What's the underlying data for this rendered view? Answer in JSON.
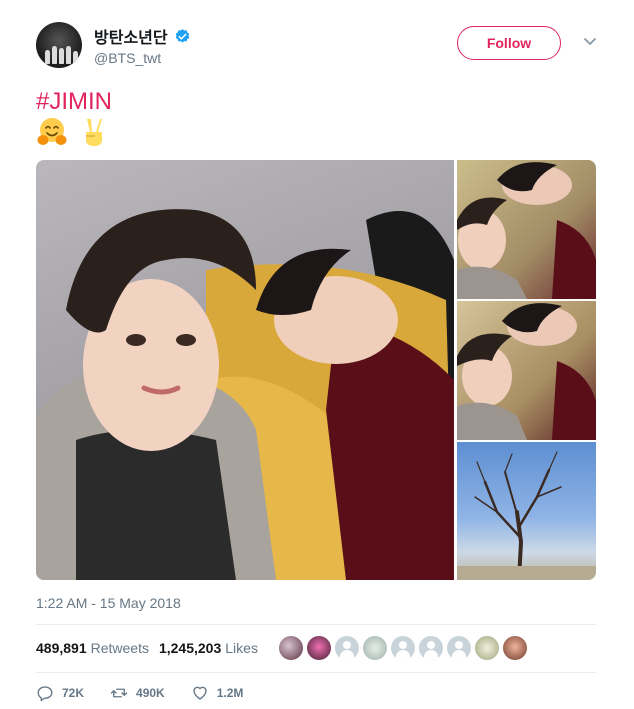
{
  "user": {
    "display_name": "방탄소년단",
    "handle": "@BTS_twt",
    "verified": true,
    "follow_label": "Follow"
  },
  "tweet": {
    "hashtag": "#JIMIN",
    "emojis": [
      "hugging-face-emoji",
      "victory-hand-emoji"
    ],
    "timestamp": "1:22 AM - 15 May 2018"
  },
  "stats": {
    "retweets_count": "489,891",
    "retweets_label": "Retweets",
    "likes_count": "1,245,203",
    "likes_label": "Likes"
  },
  "actions": {
    "replies": "72K",
    "retweets": "490K",
    "likes": "1.2M"
  },
  "colors": {
    "accent": "#e0245e",
    "verified": "#1da1f2",
    "muted": "#657786"
  }
}
